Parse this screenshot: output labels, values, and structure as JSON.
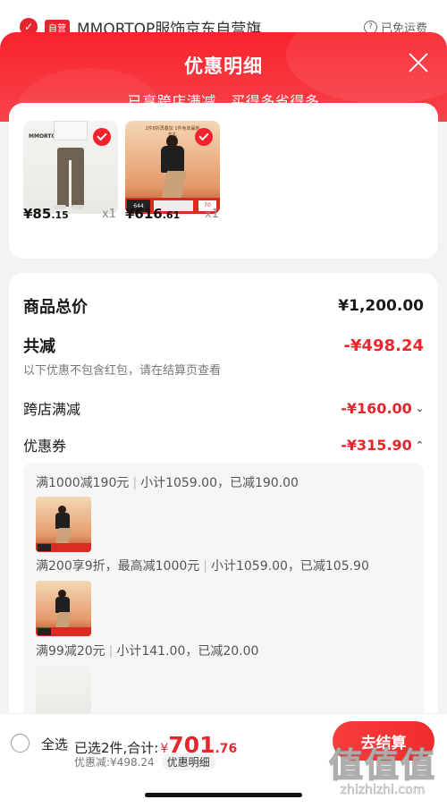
{
  "under_header": {
    "shop_tag": "自营",
    "shop_name": "MMORTOP服饰京东自营旗",
    "right_text": "已免运费"
  },
  "sheet": {
    "title": "优惠明细",
    "subtitle": "已享跨店满减，买得多省得多"
  },
  "products": [
    {
      "price_int": "¥85",
      "price_dec": ".15",
      "qty": "x1",
      "brand_mini": "MMORTOP"
    },
    {
      "price_int": "¥616",
      "price_dec": ".61",
      "qty": "x1",
      "banner": "2件8折再叠加 1件免单赢新年礼"
    }
  ],
  "summary": {
    "total_label": "商品总价",
    "total_value": "¥1,200.00",
    "reduce_label": "共减",
    "reduce_value": "-¥498.24",
    "note": "以下优惠不包含红包，请在结算页查看",
    "cross_label": "跨店满减",
    "cross_value": "-¥160.00",
    "coupon_label": "优惠券",
    "coupon_value": "-¥315.90"
  },
  "coupon_details": [
    {
      "rule": "满1000减190元",
      "subtotal": "小计1059.00，已减190.00"
    },
    {
      "rule": "满200享9折，最高减1000元",
      "subtotal": "小计1059.00，已减105.90"
    },
    {
      "rule": "满99减20元",
      "subtotal": "小计141.00，已减20.00"
    }
  ],
  "bottom_bar": {
    "select_all": "全选",
    "selected_text": "已选2件,合计:",
    "currency": "¥",
    "amount_int": "701",
    "amount_dec": ".76",
    "discount_text": "优惠减:¥498.24",
    "detail_chip": "优惠明细",
    "checkout": "去结算"
  },
  "watermark": {
    "logo": "值值值",
    "url": "zhizhizhi.com"
  },
  "colors": {
    "brand_red": "#f8232c",
    "price_red": "#e3262e"
  }
}
